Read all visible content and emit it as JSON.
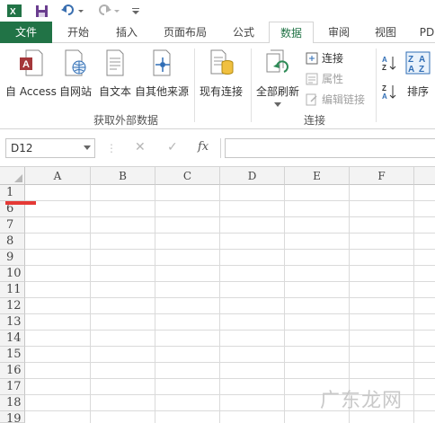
{
  "tabs": {
    "file": "文件",
    "items": [
      "开始",
      "插入",
      "页面布局",
      "公式",
      "数据",
      "审阅",
      "视图",
      "PD"
    ],
    "active": "数据"
  },
  "ribbon": {
    "external_data": {
      "buttons": [
        "自 Access",
        "自网站",
        "自文本",
        "自其他来源",
        "现有连接"
      ],
      "group_label": "获取外部数据"
    },
    "connections": {
      "refresh_all": "全部刷新",
      "connections": "连接",
      "properties": "属性",
      "edit_links": "编辑链接",
      "group_label": "连接"
    },
    "sort": {
      "sort_label": "排序"
    },
    "colors": {
      "excel_green": "#217346",
      "access_red": "#a4373a"
    }
  },
  "formula_bar": {
    "name_box": "D12",
    "fx_label": "fx",
    "cancel_symbol": "✕",
    "enter_symbol": "✓"
  },
  "grid": {
    "columns": [
      "A",
      "B",
      "C",
      "D",
      "E",
      "F"
    ],
    "rows": [
      "1",
      "6",
      "7",
      "8",
      "9",
      "10",
      "11",
      "12",
      "13",
      "14",
      "15",
      "16",
      "17",
      "18",
      "19"
    ]
  },
  "watermark": "广东龙网"
}
